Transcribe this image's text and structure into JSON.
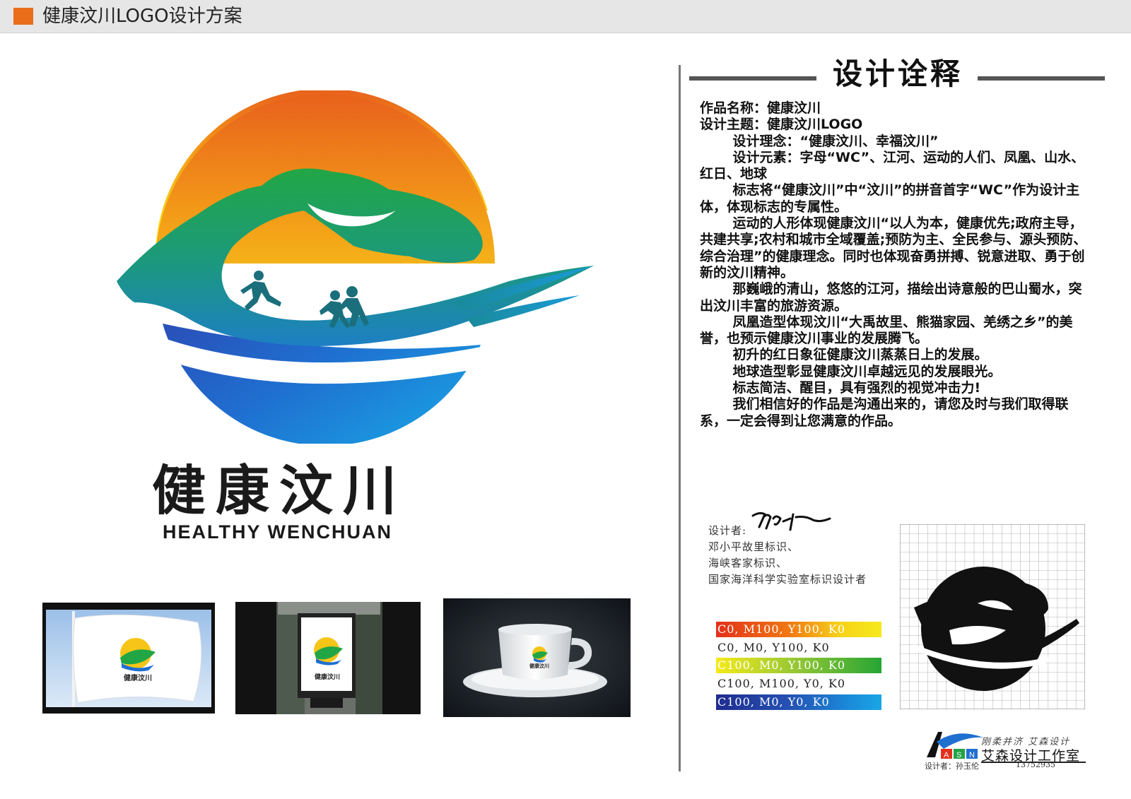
{
  "header": {
    "title": "健康汶川LOGO设计方案",
    "accent_color": "#ea6d1a"
  },
  "logo": {
    "name_cn": "健康汶川",
    "name_en": "HEALTHY WENCHUAN",
    "colors": {
      "sun_top": "#e8611c",
      "sun_mid": "#f6c518",
      "green": "#21a344",
      "teal": "#1a9a8a",
      "blue": "#1f6fd0"
    }
  },
  "mockups": {
    "flag_text": "健康汶川",
    "billboard_text": "健康汶川",
    "cup_text": "健康汶川"
  },
  "description": {
    "section_title": "设计诠释",
    "lines": [
      "作品名称：健康汶川",
      "设计主题：健康汶川LOGO",
      "设计理念：“健康汶川、幸福汶川”",
      "设计元素：字母“WC”、江河、运动的人们、凤凰、山水、红日、地球",
      "标志将“健康汶川”中“汶川”的拼音首字“WC”作为设计主体，体现标志的专属性。",
      "运动的人形体现健康汶川“以人为本，健康优先;政府主导，共建共享;农村和城市全域覆盖;预防为主、全民参与、源头预防、综合治理”的健康理念。同时也体现奋勇拼搏、锐意进取、勇于创新的汶川精神。",
      "那巍峨的清山，悠悠的江河，描绘出诗意般的巴山蜀水，突出汶川丰富的旅游资源。",
      "凤凰造型体现汶川“大禹故里、熊猫家园、羌绣之乡”的美誉，也预示健康汶川事业的发展腾飞。",
      "初升的红日象征健康汶川蒸蒸日上的发展。",
      "地球造型彰显健康汶川卓越远见的发展眼光。",
      "标志简洁、醒目，具有强烈的视觉冲击力!",
      "我们相信好的作品是沟通出来的，请您及时与我们取得联系，一定会得到让您满意的作品。"
    ]
  },
  "designer": {
    "label": "设计者:",
    "credits": [
      "邓小平故里标识、",
      "海峡客家标识、",
      "国家海洋科学实验室标识设计者"
    ]
  },
  "color_specs": [
    "C0, M100, Y100, K0",
    "C0, M0, Y100, K0",
    "C100, M0, Y100, K0",
    "C100, M100, Y0, K0",
    "C100, M0, Y0, K0"
  ],
  "studio": {
    "slogan": "刚柔并济  艾森设计",
    "name": "艾森设计工作室",
    "designer_line": "设计者：孙玉伦",
    "phone": "13752935"
  }
}
